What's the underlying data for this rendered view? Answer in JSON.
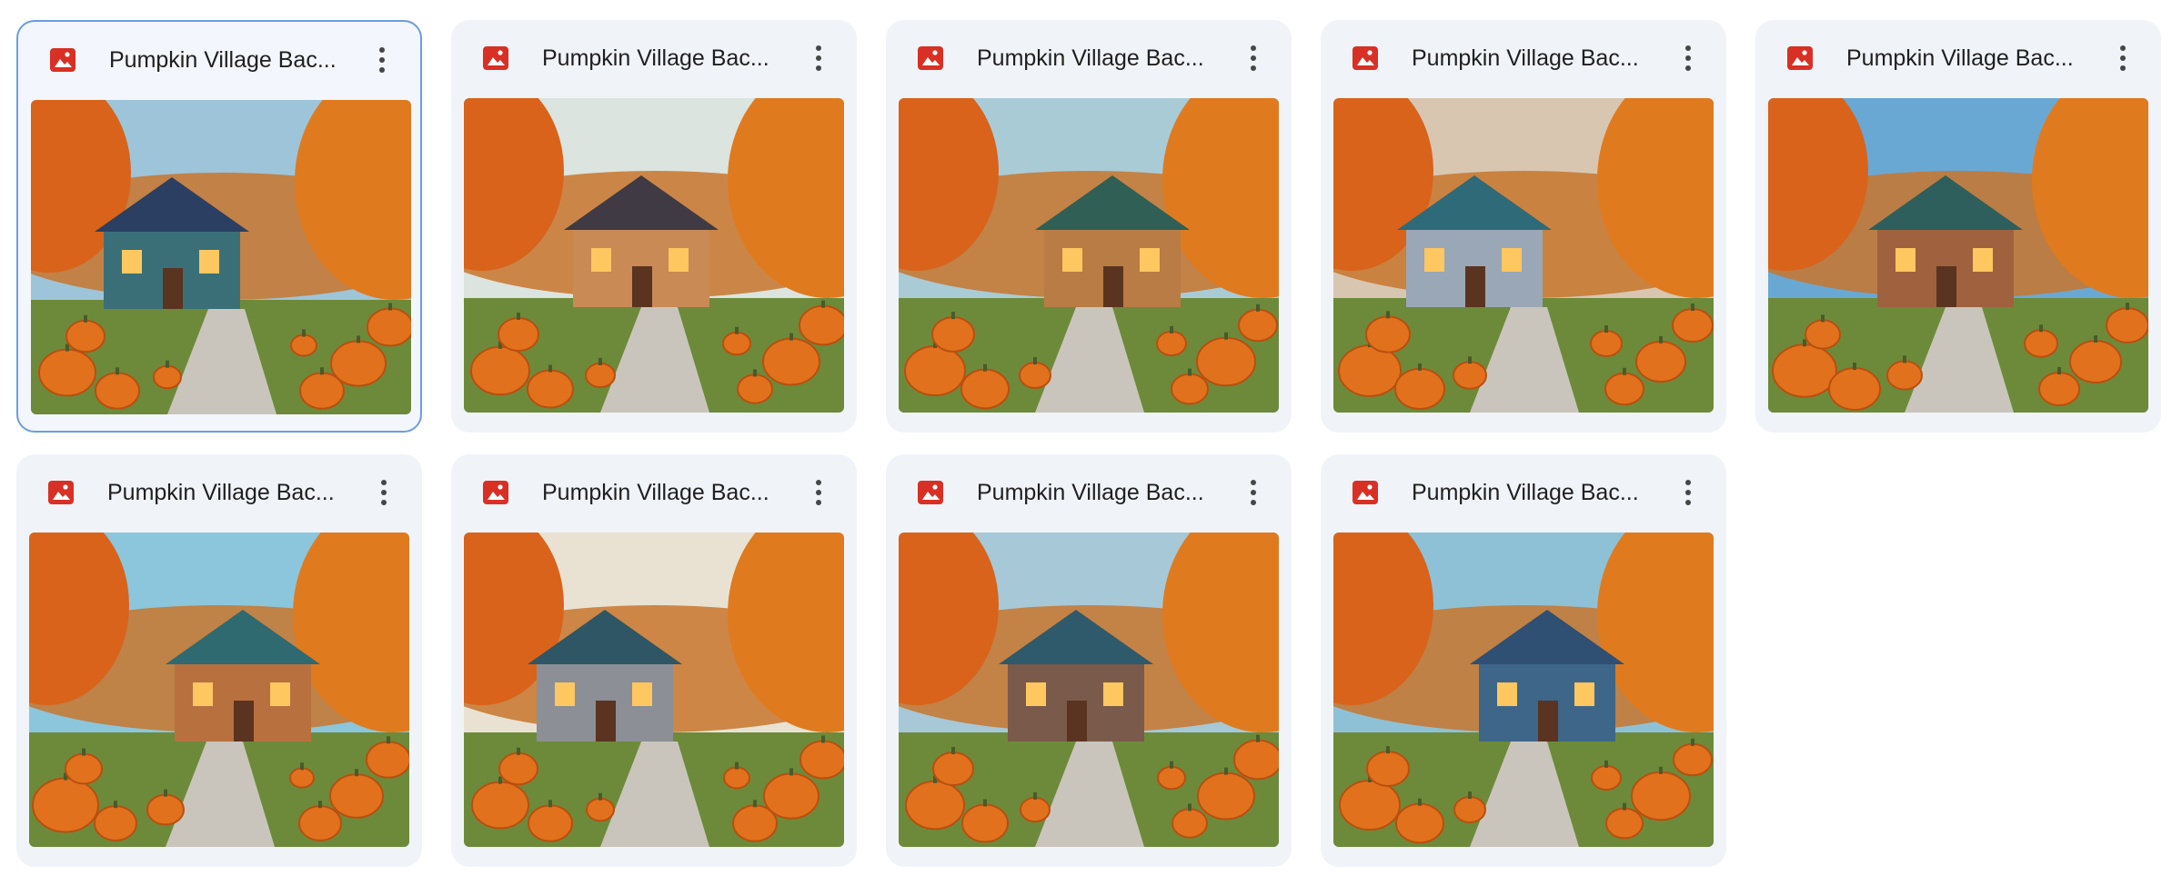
{
  "files": [
    {
      "name": "Pumpkin Village Bac...",
      "selected": true,
      "icon": "image-file-icon",
      "sky": "#9ec4d9",
      "house": "#3b6f78",
      "roof": "#2b3f63"
    },
    {
      "name": "Pumpkin Village Bac...",
      "selected": false,
      "icon": "image-file-icon",
      "sky": "#dbe4df",
      "house": "#c98a55",
      "roof": "#3f3a44"
    },
    {
      "name": "Pumpkin Village Bac...",
      "selected": false,
      "icon": "image-file-icon",
      "sky": "#a9cbd6",
      "house": "#b97c45",
      "roof": "#2f5f55"
    },
    {
      "name": "Pumpkin Village Bac...",
      "selected": false,
      "icon": "image-file-icon",
      "sky": "#d8c6b1",
      "house": "#9aa7b6",
      "roof": "#2f6a78"
    },
    {
      "name": "Pumpkin Village Bac...",
      "selected": false,
      "icon": "image-file-icon",
      "sky": "#6aa8d4",
      "house": "#a0613f",
      "roof": "#2e5f5c"
    },
    {
      "name": "Pumpkin Village Bac...",
      "selected": false,
      "icon": "image-file-icon",
      "sky": "#8cc6dc",
      "house": "#b9703f",
      "roof": "#2e6a70"
    },
    {
      "name": "Pumpkin Village Bac...",
      "selected": false,
      "icon": "image-file-icon",
      "sky": "#e9e2d2",
      "house": "#8c8f95",
      "roof": "#2e5664"
    },
    {
      "name": "Pumpkin Village Bac...",
      "selected": false,
      "icon": "image-file-icon",
      "sky": "#a7c8d6",
      "house": "#7a5a4a",
      "roof": "#2f5a6b"
    },
    {
      "name": "Pumpkin Village Bac...",
      "selected": false,
      "icon": "image-file-icon",
      "sky": "#8fc1d6",
      "house": "#3e6688",
      "roof": "#2f4f73"
    }
  ],
  "colors": {
    "card_bg": "#f0f4f9",
    "selected_border": "#6d9ce0",
    "icon_red": "#d93025"
  }
}
